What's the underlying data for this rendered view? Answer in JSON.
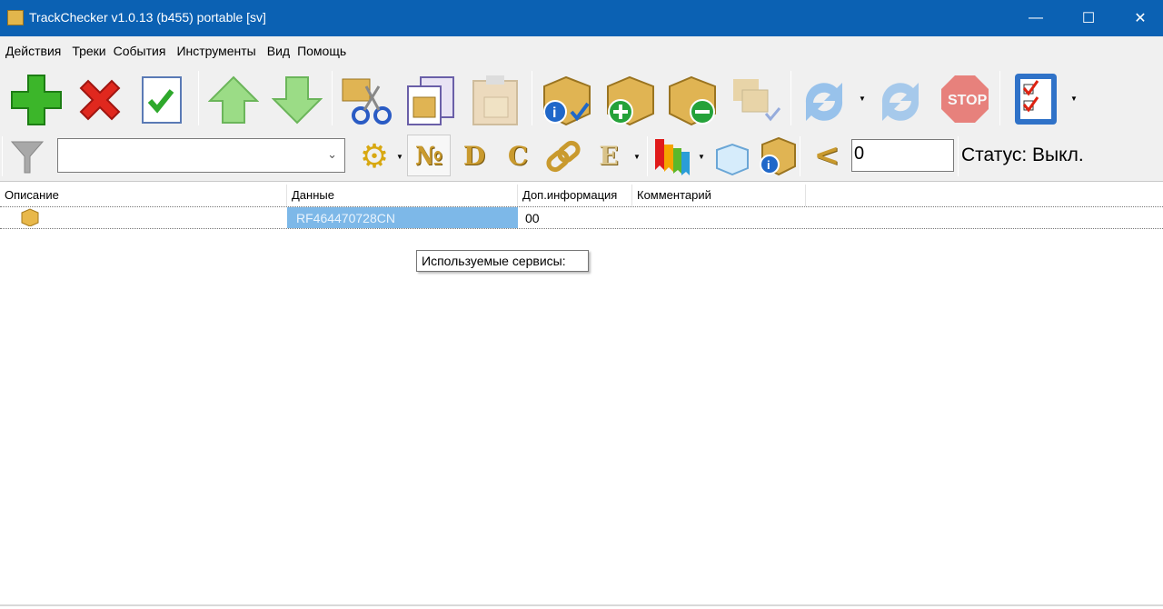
{
  "window": {
    "title": "TrackChecker v1.0.13 (b455)  portable [sv]",
    "minimize": "—",
    "maximize": "☐",
    "close": "✕"
  },
  "menu": [
    "Действия",
    "Треки",
    "События",
    "Инструменты",
    "Вид",
    "Помощь"
  ],
  "toolbar2": {
    "letters": {
      "number": "№",
      "d": "D",
      "c": "C",
      "e": "E",
      "less": "<"
    },
    "filter_value": "",
    "counter_value": "0",
    "status": "Статус: Выкл."
  },
  "table": {
    "columns": [
      "Описание",
      "Данные",
      "Доп.информация",
      "Комментарий"
    ],
    "rows": [
      {
        "description": "",
        "data": "RF464470728CN",
        "extra": "00",
        "comment": ""
      }
    ]
  },
  "tooltip": "Используемые сервисы:",
  "colors": {
    "titlebar": "#0b61b3",
    "selection": "#7db8e8"
  }
}
